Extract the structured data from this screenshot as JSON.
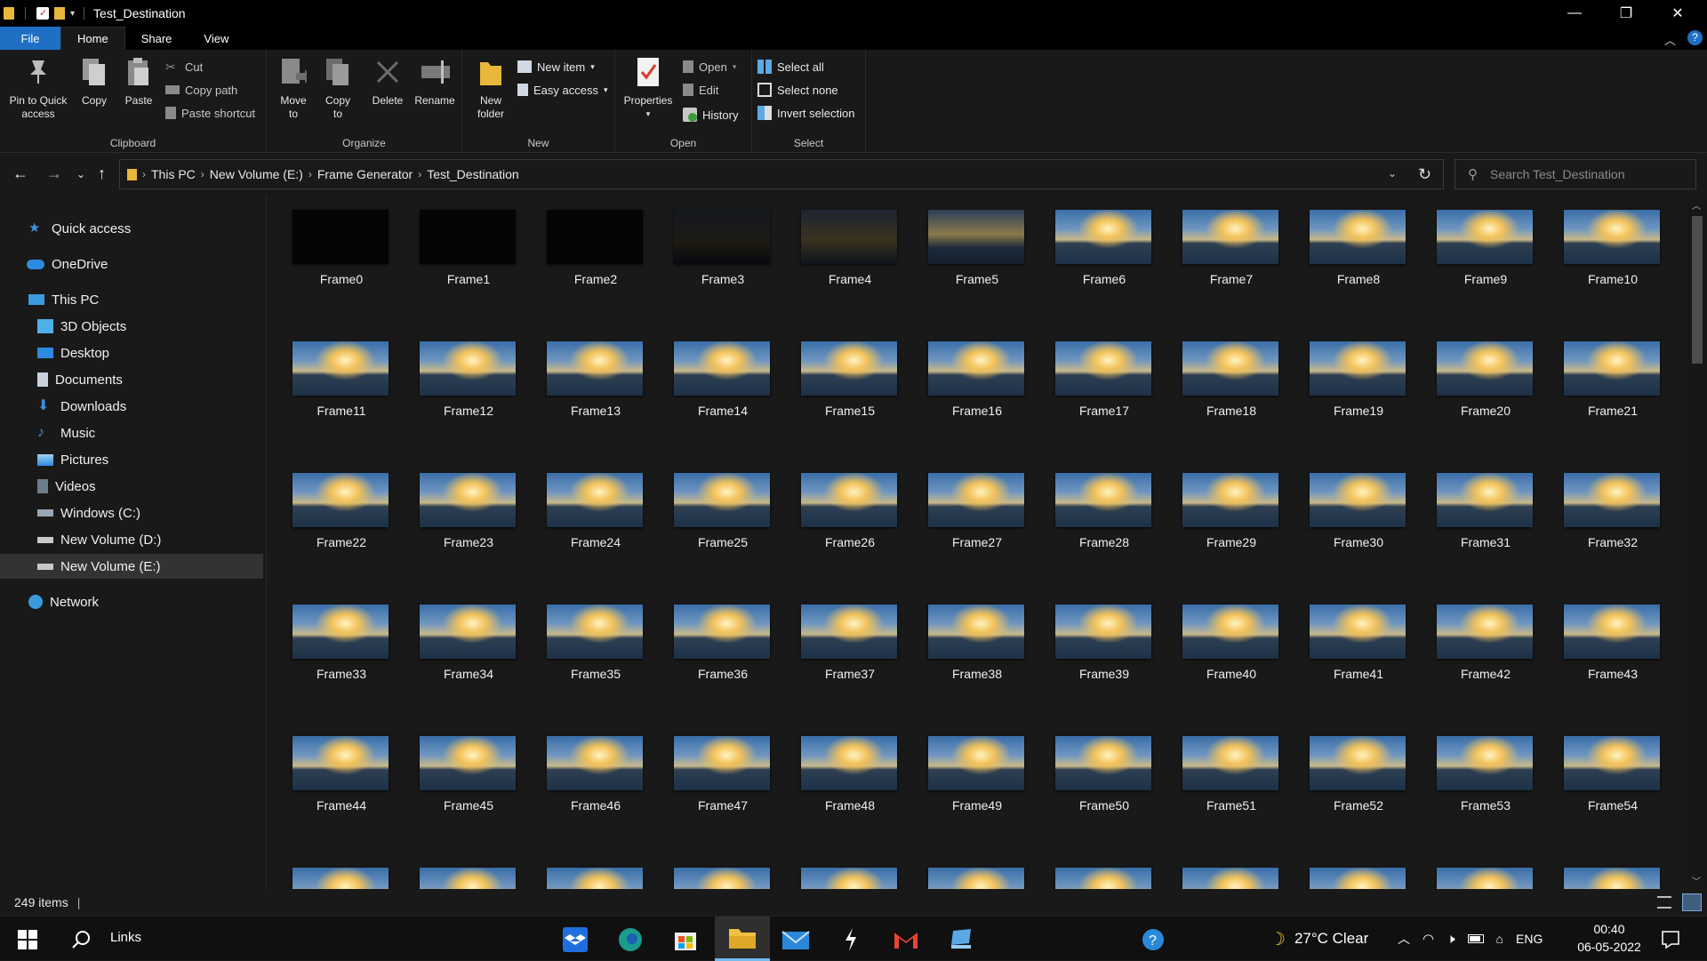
{
  "window": {
    "title": "Test_Destination",
    "minimize": "—",
    "restore": "❐",
    "close": "✕"
  },
  "ribbon_tabs": [
    "File",
    "Home",
    "Share",
    "View"
  ],
  "ribbon": {
    "clipboard": {
      "label": "Clipboard",
      "pin_line1": "Pin to Quick",
      "pin_line2": "access",
      "copy": "Copy",
      "paste": "Paste",
      "cut": "Cut",
      "copy_path": "Copy path",
      "paste_shortcut": "Paste shortcut"
    },
    "organize": {
      "label": "Organize",
      "move_line1": "Move",
      "move_line2": "to",
      "copyto_line1": "Copy",
      "copyto_line2": "to",
      "delete": "Delete",
      "rename": "Rename"
    },
    "new": {
      "label": "New",
      "folder_line1": "New",
      "folder_line2": "folder",
      "new_item": "New item",
      "easy_access": "Easy access"
    },
    "open": {
      "label": "Open",
      "properties": "Properties",
      "open": "Open",
      "edit": "Edit",
      "history": "History"
    },
    "select": {
      "label": "Select",
      "select_all": "Select all",
      "select_none": "Select none",
      "invert": "Invert selection"
    }
  },
  "breadcrumb": [
    "This PC",
    "New Volume (E:)",
    "Frame Generator",
    "Test_Destination"
  ],
  "search": {
    "placeholder": "Search Test_Destination"
  },
  "navpane": {
    "quick_access": "Quick access",
    "onedrive": "OneDrive",
    "this_pc": "This PC",
    "objects3d": "3D Objects",
    "desktop": "Desktop",
    "documents": "Documents",
    "downloads": "Downloads",
    "music": "Music",
    "pictures": "Pictures",
    "videos": "Videos",
    "windows_c": "Windows (C:)",
    "volume_d": "New Volume (D:)",
    "volume_e": "New Volume (E:)",
    "network": "Network"
  },
  "files": [
    "Frame0",
    "Frame1",
    "Frame2",
    "Frame3",
    "Frame4",
    "Frame5",
    "Frame6",
    "Frame7",
    "Frame8",
    "Frame9",
    "Frame10",
    "Frame11",
    "Frame12",
    "Frame13",
    "Frame14",
    "Frame15",
    "Frame16",
    "Frame17",
    "Frame18",
    "Frame19",
    "Frame20",
    "Frame21",
    "Frame22",
    "Frame23",
    "Frame24",
    "Frame25",
    "Frame26",
    "Frame27",
    "Frame28",
    "Frame29",
    "Frame30",
    "Frame31",
    "Frame32",
    "Frame33",
    "Frame34",
    "Frame35",
    "Frame36",
    "Frame37",
    "Frame38",
    "Frame39",
    "Frame40",
    "Frame41",
    "Frame42",
    "Frame43",
    "Frame44",
    "Frame45",
    "Frame46",
    "Frame47",
    "Frame48",
    "Frame49",
    "Frame50",
    "Frame51",
    "Frame52",
    "Frame53",
    "Frame54"
  ],
  "status": {
    "item_count": "249 items"
  },
  "taskbar": {
    "search_label": "Links",
    "weather": "27°C  Clear",
    "lang": "ENG",
    "time": "00:40",
    "date": "06-05-2022"
  },
  "colors": {
    "accent": "#1f6fc5",
    "background": "#191919"
  }
}
